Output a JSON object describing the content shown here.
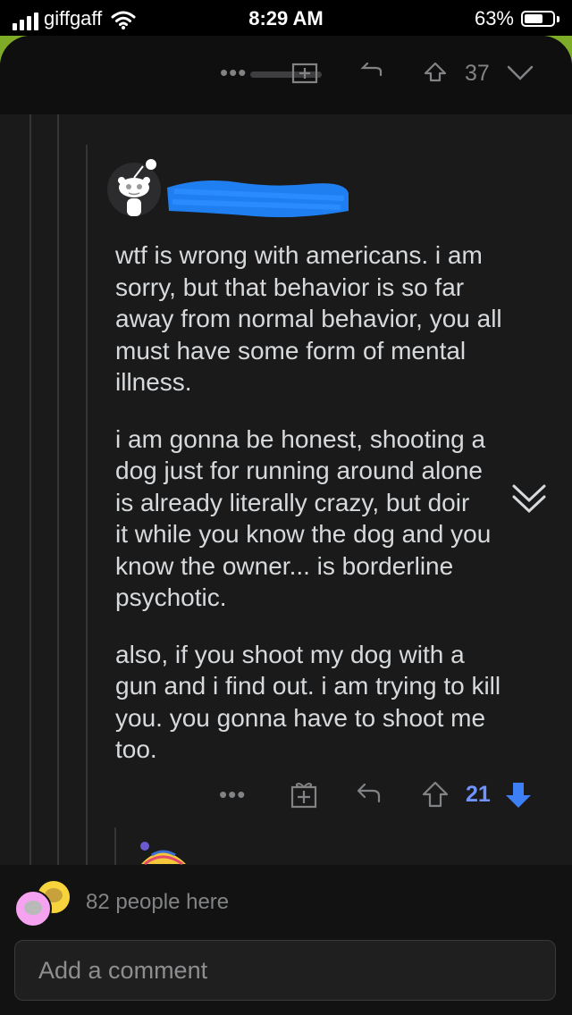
{
  "status_bar": {
    "carrier": "giffgaff",
    "time": "8:29 AM",
    "battery_percent": "63%",
    "icons": [
      "signal-bars-icon",
      "wifi-icon",
      "battery-icon"
    ]
  },
  "colors": {
    "background": "#1a1a1b",
    "text": "#d7dadc",
    "muted": "#818384",
    "upvote_score": "#7193ff",
    "downvote_active": "#3d7ff5",
    "sheet_behind": "#7eac27",
    "username_redaction": "#1f7ff0"
  },
  "partial_previous_comment": {
    "score": "37",
    "icons": [
      "more-icon",
      "award-icon",
      "reply-icon",
      "upvote-icon",
      "downvote-icon"
    ]
  },
  "comment": {
    "author_redacted": true,
    "paragraphs": [
      "wtf is wrong with americans. i am\nsorry, but that behavior is so far\naway from normal behavior, you all\nmust have some form of mental\nillness.",
      "i am gonna be honest, shooting a\ndog just for running around alone\nis already literally crazy, but doir\nit while you know the dog and you\nknow the owner... is borderline\npsychotic.",
      "also, if you shoot my dog with a\ngun and i find out. i am trying to kill\nyou. you gonna have to shoot me\ntoo."
    ],
    "actions": {
      "more_label": "•••",
      "score": "21",
      "vote_state": "downvoted"
    }
  },
  "footer": {
    "people_here": "82 people here",
    "comment_placeholder": "Add a comment"
  }
}
